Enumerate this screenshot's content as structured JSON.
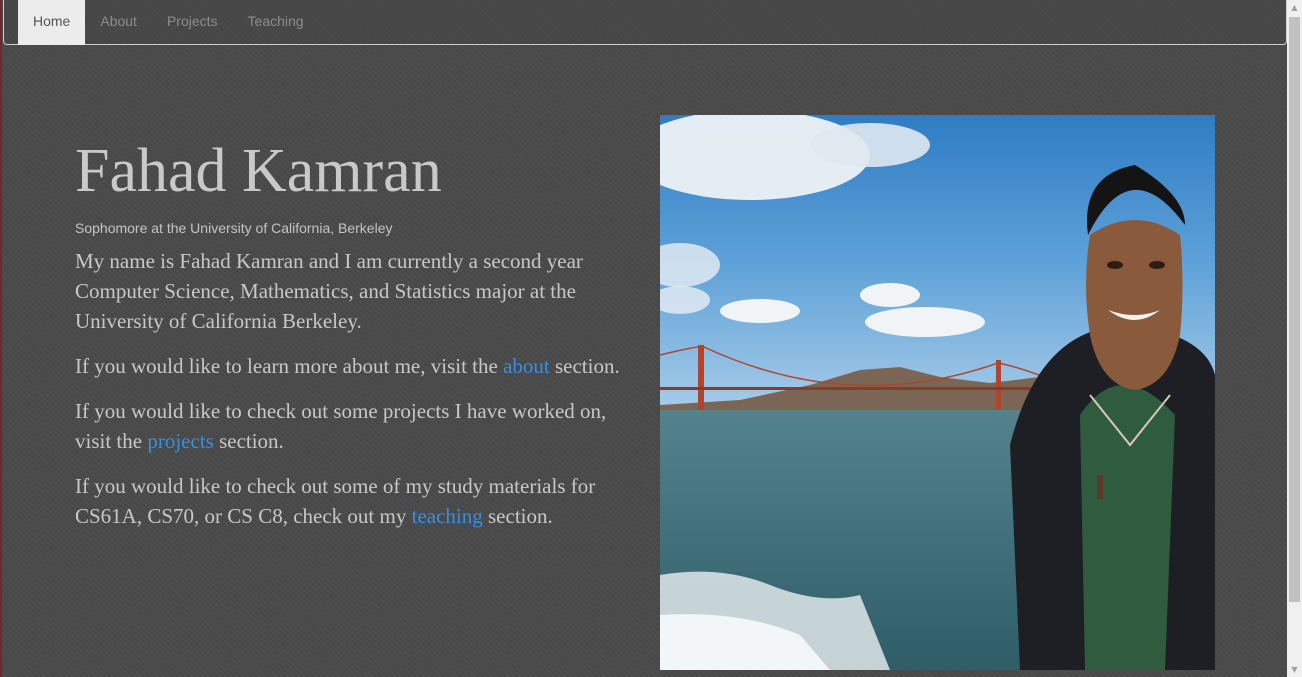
{
  "nav": {
    "items": [
      "Home",
      "About",
      "Projects",
      "Teaching"
    ],
    "active": "Home"
  },
  "hero": {
    "name": "Fahad Kamran",
    "subtitle": "Sophomore at the University of California, Berkeley",
    "intro": "My name is Fahad Kamran and I am currently a second year Computer Science, Mathematics, and Statistics major at the University of California Berkeley.",
    "about_pre": "If you would like to learn more about me, visit the ",
    "about_link": "about",
    "about_post": " section.",
    "projects_pre": "If you would like to check out some projects I have worked on, visit the ",
    "projects_link": "projects",
    "projects_post": " section.",
    "teaching_pre": "If you would like to check out some of my study materials for CS61A, CS70, or CS C8, check out my ",
    "teaching_link": "teaching",
    "teaching_post": " section."
  },
  "colors": {
    "link": "#3a8ee0",
    "background": "#4a4a4a",
    "text": "#c8c8c8"
  }
}
